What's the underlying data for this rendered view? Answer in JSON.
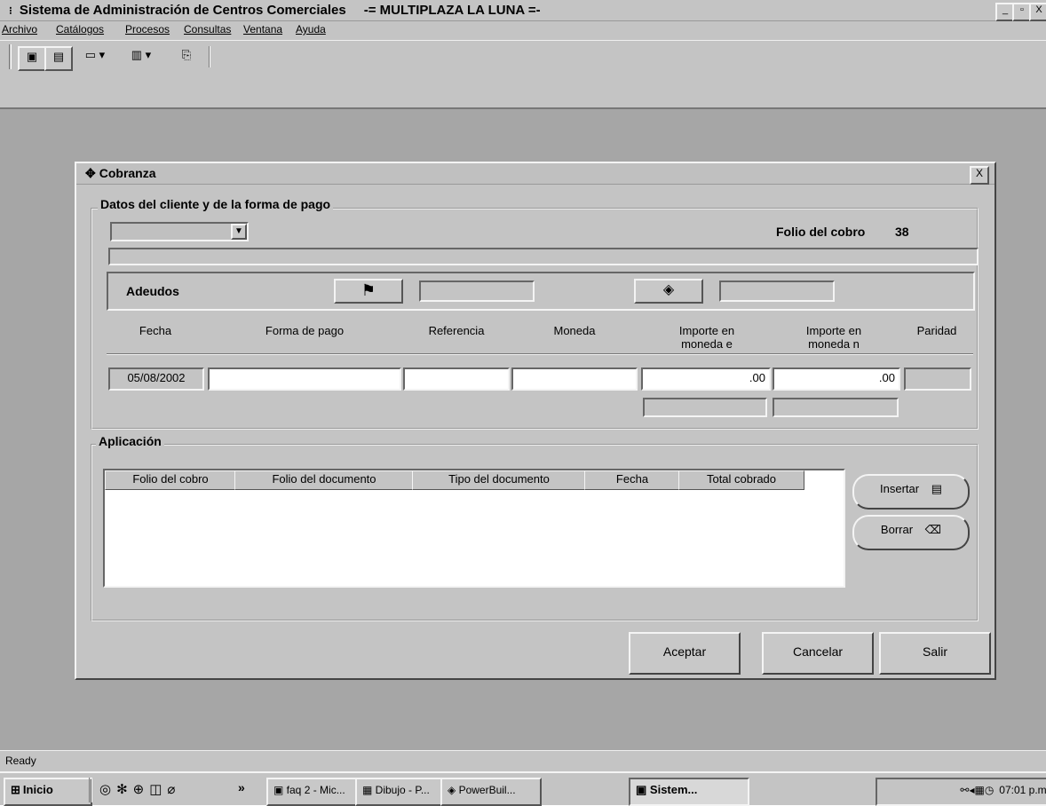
{
  "app": {
    "title": "Sistema de Administración de Centros Comerciales",
    "subtitle": "-= MULTIPLAZA LA LUNA =-",
    "window_buttons": [
      "_",
      "▫",
      "X"
    ]
  },
  "menu": [
    "Archivo",
    "Catálogos",
    "Procesos",
    "Consultas",
    "Ventana",
    "Ayuda"
  ],
  "dialog": {
    "title": "Cobranza",
    "close_label": "X",
    "section_client": {
      "legend": "Datos del cliente y de la forma de pago",
      "folio_label": "Folio del cobro",
      "folio_value": "38",
      "adeudos_label": "Adeudos"
    },
    "payment_columns": [
      "Fecha",
      "Forma de pago",
      "Referencia",
      "Moneda",
      "Importe en moneda e",
      "Importe en moneda n",
      "Paridad"
    ],
    "payment_row": {
      "fecha": "05/08/2002",
      "forma_pago": "",
      "referencia": "",
      "moneda": "",
      "importe_e": ".00",
      "importe_n": ".00",
      "paridad": ""
    },
    "section_app": {
      "legend": "Aplicación",
      "columns": [
        "Folio del cobro",
        "Folio del documento",
        "Tipo del documento",
        "Fecha",
        "Total cobrado"
      ],
      "insert_label": "Insertar",
      "delete_label": "Borrar"
    },
    "buttons": {
      "accept": "Aceptar",
      "cancel": "Cancelar",
      "exit": "Salir"
    }
  },
  "status": "Ready",
  "taskbar": {
    "start": "Inicio",
    "tasks": [
      "faq 2 - Mic...",
      "Dibujo - P...",
      "PowerBuil...",
      "Sistem..."
    ],
    "clock": "07:01 p.m."
  }
}
